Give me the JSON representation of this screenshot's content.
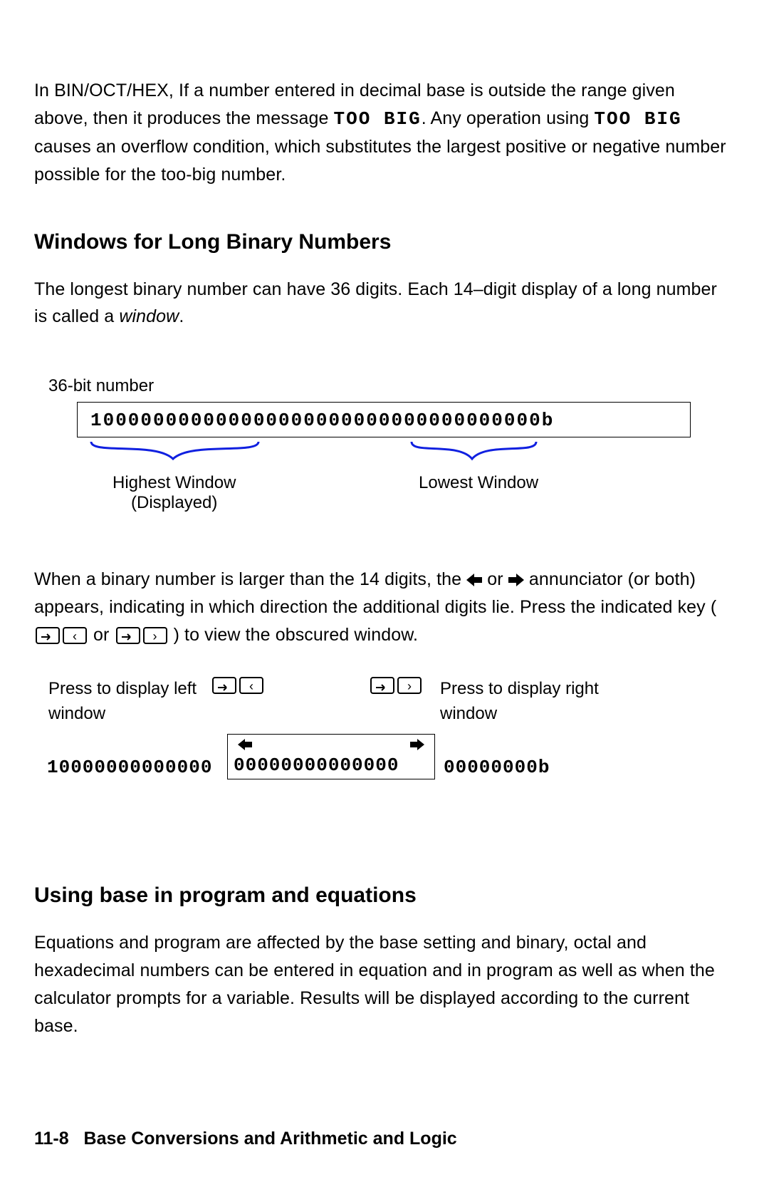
{
  "p1a": "In BIN/OCT/HEX, If a number entered in decimal base is outside the range given above, then it produces the message ",
  "msg1": "TOO BIG",
  "p1b": ". Any operation using ",
  "msg2": "TOO BIG",
  "p1c": " causes an overflow condition, which substitutes the largest positive or negative number possible for the too-big number.",
  "h2a": "Windows for Long Binary Numbers",
  "p2a": "The longest binary number can have 36 digits. Each 14–digit display of a long number is called a ",
  "p2b": "window",
  "p2c": ".",
  "fig1": {
    "top_caption": "36-bit number",
    "display_number": "100000000000000000000000000000000000b",
    "high_label_l1": "Highest Window",
    "high_label_l2": "(Displayed)",
    "low_label": "Lowest Window"
  },
  "p3a": "When a binary number is larger than the 14 digits, the ",
  "p3b": " or ",
  "p3c": " annunciator (or both) appears, indicating in which direction the additional digits lie. Press the indicated key (",
  "p3d": " or ",
  "p3e": " ) to view the obscured window.",
  "fig2": {
    "left_lbl_l1": "Press to display left",
    "left_lbl_l2": "window",
    "right_lbl_l1": "Press to display right",
    "right_lbl_l2": "window",
    "seg_left": "10000000000000",
    "seg_mid": "00000000000000",
    "seg_right": "00000000b"
  },
  "h2b": "Using base in program and equations",
  "p4": "Equations and program are affected by the base setting and binary, octal and hexadecimal numbers can be entered in equation and in program as well as when the calculator prompts for a variable.  Results will be displayed according to the current base.",
  "footer_page": "11-8",
  "footer_title": "Base Conversions and Arithmetic and Logic"
}
